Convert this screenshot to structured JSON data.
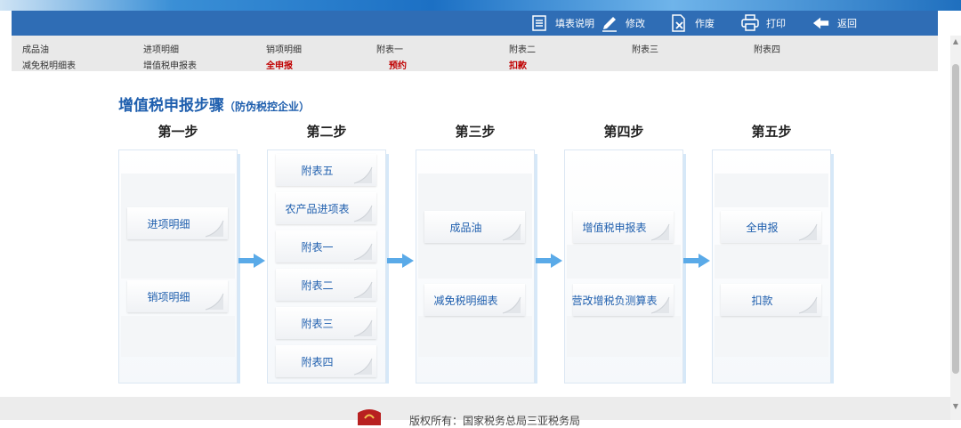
{
  "toolbar": {
    "buttons": [
      {
        "label": "填表说明",
        "icon": "document-list-icon"
      },
      {
        "label": "修改",
        "icon": "pencil-icon"
      },
      {
        "label": "作废",
        "icon": "cancel-document-icon"
      },
      {
        "label": "打印",
        "icon": "printer-icon"
      },
      {
        "label": "返回",
        "icon": "back-arrow-icon"
      }
    ]
  },
  "subnav": {
    "row1": [
      "成品油",
      "进项明细",
      "销项明细",
      "附表一",
      "附表二",
      "附表三",
      "附表四"
    ],
    "row2": [
      "减免税明细表",
      "增值税申报表",
      "全申报",
      "预约",
      "扣款"
    ]
  },
  "main": {
    "title": "增值税申报步骤",
    "subtitle": "（防伪税控企业）"
  },
  "steps": [
    {
      "title": "第一步",
      "items": [
        "进项明细",
        "销项明细"
      ]
    },
    {
      "title": "第二步",
      "items": [
        "附表五",
        "农产品进项表",
        "附表一",
        "附表二",
        "附表三",
        "附表四"
      ]
    },
    {
      "title": "第三步",
      "items": [
        "成品油",
        "减免税明细表"
      ]
    },
    {
      "title": "第四步",
      "items": [
        "增值税申报表",
        "营改增税负测算表"
      ]
    },
    {
      "title": "第五步",
      "items": [
        "全申报",
        "扣款"
      ]
    }
  ],
  "footer": {
    "text": "版权所有：国家税务总局三亚税务局"
  },
  "colors": {
    "toolbar": "#2f6db5",
    "accent": "#1f5fae",
    "highlight_red": "#c00000",
    "arrow": "#5aaae8"
  }
}
